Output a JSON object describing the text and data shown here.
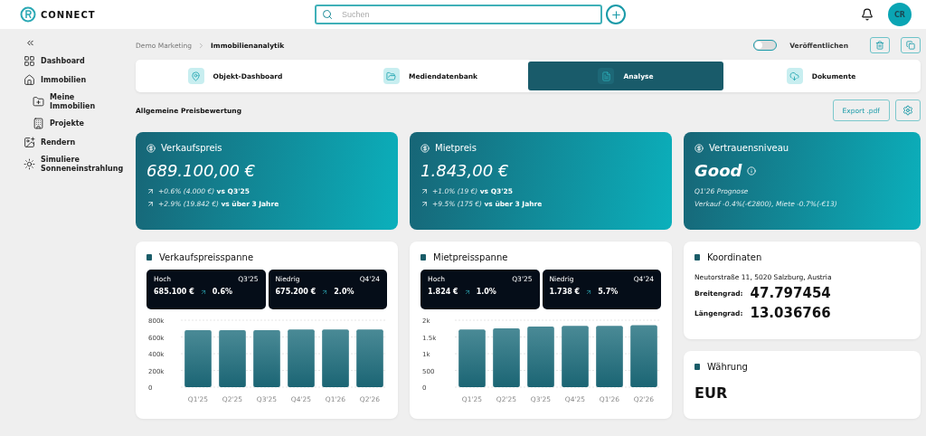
{
  "header": {
    "logo_text": "CONNECT",
    "search": {
      "placeholder": "Suchen"
    },
    "avatar": "CR"
  },
  "sidebar": {
    "items": [
      {
        "label": "Dashboard"
      },
      {
        "label": "Immobilien",
        "children": [
          {
            "label": "Meine Immobilien"
          },
          {
            "label": "Projekte"
          }
        ]
      },
      {
        "label": "Rendern"
      },
      {
        "label": "Simuliere Sonneneinstrahlung"
      }
    ]
  },
  "breadcrumb": [
    "Demo Marketing",
    "Immobilienanalytik"
  ],
  "publish": {
    "label": "Veröffentlichen",
    "on": false
  },
  "tabs": [
    {
      "label": "Objekt-Dashboard",
      "selected": false
    },
    {
      "label": "Mediendatenbank",
      "selected": false
    },
    {
      "label": "Analyse",
      "selected": true
    },
    {
      "label": "Dokumente",
      "selected": false
    }
  ],
  "section_title": "Allgemeine Preisbewertung",
  "export_button": "Export .pdf",
  "kpis": [
    {
      "title": "Verkaufspreis",
      "value": "689.100,00 €",
      "lines": [
        {
          "change": "+0.6% (4.000 €)",
          "ref": "vs Q3'25"
        },
        {
          "change": "+2.9% (19.842 €)",
          "ref": "vs über 3 Jahre"
        }
      ]
    },
    {
      "title": "Mietpreis",
      "value": "1.843,00 €",
      "lines": [
        {
          "change": "+1.0% (19 €)",
          "ref": "vs Q3'25"
        },
        {
          "change": "+9.5% (175 €)",
          "ref": "vs über 3 Jahre"
        }
      ]
    },
    {
      "title": "Vertrauensniveau",
      "value": "Good",
      "subtitle": "Q1'26 Prognose",
      "note": "Verkauf -0.4%(-€2800), Miete -0.7%(-€13)"
    }
  ],
  "ranges": [
    {
      "title": "Verkaufspreisspanne",
      "stats": [
        {
          "label": "Hoch",
          "period": "Q3'25",
          "value": "685.100 €",
          "change": "0.6%"
        },
        {
          "label": "Niedrig",
          "period": "Q4'24",
          "value": "675.200 €",
          "change": "2.0%"
        }
      ],
      "chart_data": {
        "type": "bar",
        "grid": true,
        "categories": [
          "Q1'25",
          "Q2'25",
          "Q3'25",
          "Q4'25",
          "Q1'26",
          "Q2'26"
        ],
        "values": [
          680000,
          680000,
          680000,
          690000,
          690000,
          690000
        ],
        "ylim": [
          0,
          800000
        ],
        "yticks": [
          {
            "value": 0,
            "label": "0"
          },
          {
            "value": 200000,
            "label": "200k"
          },
          {
            "value": 400000,
            "label": "400k"
          },
          {
            "value": 600000,
            "label": "600k"
          },
          {
            "value": 800000,
            "label": "800k"
          }
        ]
      }
    },
    {
      "title": "Mietpreisspanne",
      "stats": [
        {
          "label": "Hoch",
          "period": "Q3'25",
          "value": "1.824 €",
          "change": "1.0%"
        },
        {
          "label": "Niedrig",
          "period": "Q4'24",
          "value": "1.738 €",
          "change": "5.7%"
        }
      ],
      "chart_data": {
        "type": "bar",
        "grid": true,
        "categories": [
          "Q1'25",
          "Q2'25",
          "Q3'25",
          "Q4'25",
          "Q1'26",
          "Q2'26"
        ],
        "values": [
          1720,
          1760,
          1810,
          1830,
          1830,
          1850
        ],
        "ylim": [
          0,
          2000
        ],
        "yticks": [
          {
            "value": 0,
            "label": "0"
          },
          {
            "value": 500,
            "label": "500"
          },
          {
            "value": 1000,
            "label": "1k"
          },
          {
            "value": 1500,
            "label": "1.5k"
          },
          {
            "value": 2000,
            "label": "2k"
          }
        ]
      }
    }
  ],
  "coordinates": {
    "title": "Koordinaten",
    "address": "Neutorstraße 11, 5020 Salzburg, Austria",
    "rows": [
      {
        "label": "Breitengrad:",
        "value": "47.797454"
      },
      {
        "label": "Längengrad:",
        "value": "13.036766"
      }
    ]
  },
  "currency": {
    "title": "Währung",
    "value": "EUR"
  }
}
